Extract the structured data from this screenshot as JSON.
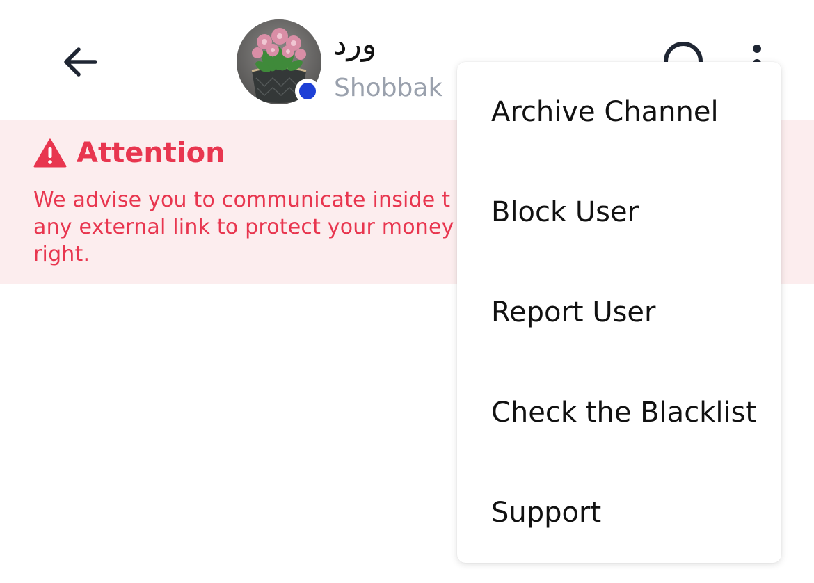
{
  "header": {
    "contact_name": "ورد",
    "contact_subtitle": "Shobbak",
    "status": "online",
    "status_color": "#1e40d6"
  },
  "attention": {
    "title": "Attention",
    "message": "We advise you to communicate inside t any external link to protect your money right.",
    "lines": [
      "We advise you to communicate inside t",
      "any external link to protect your money",
      "right."
    ],
    "text_color": "#e8364f",
    "background_color": "#fcedee"
  },
  "menu": {
    "items": [
      {
        "label": "Archive Channel"
      },
      {
        "label": "Block User"
      },
      {
        "label": "Report User"
      },
      {
        "label": "Check the Blacklist"
      },
      {
        "label": "Support"
      }
    ]
  },
  "icons": {
    "back": "arrow-left-icon",
    "search": "search-icon",
    "more": "more-vertical-icon",
    "warning": "warning-triangle-icon"
  }
}
